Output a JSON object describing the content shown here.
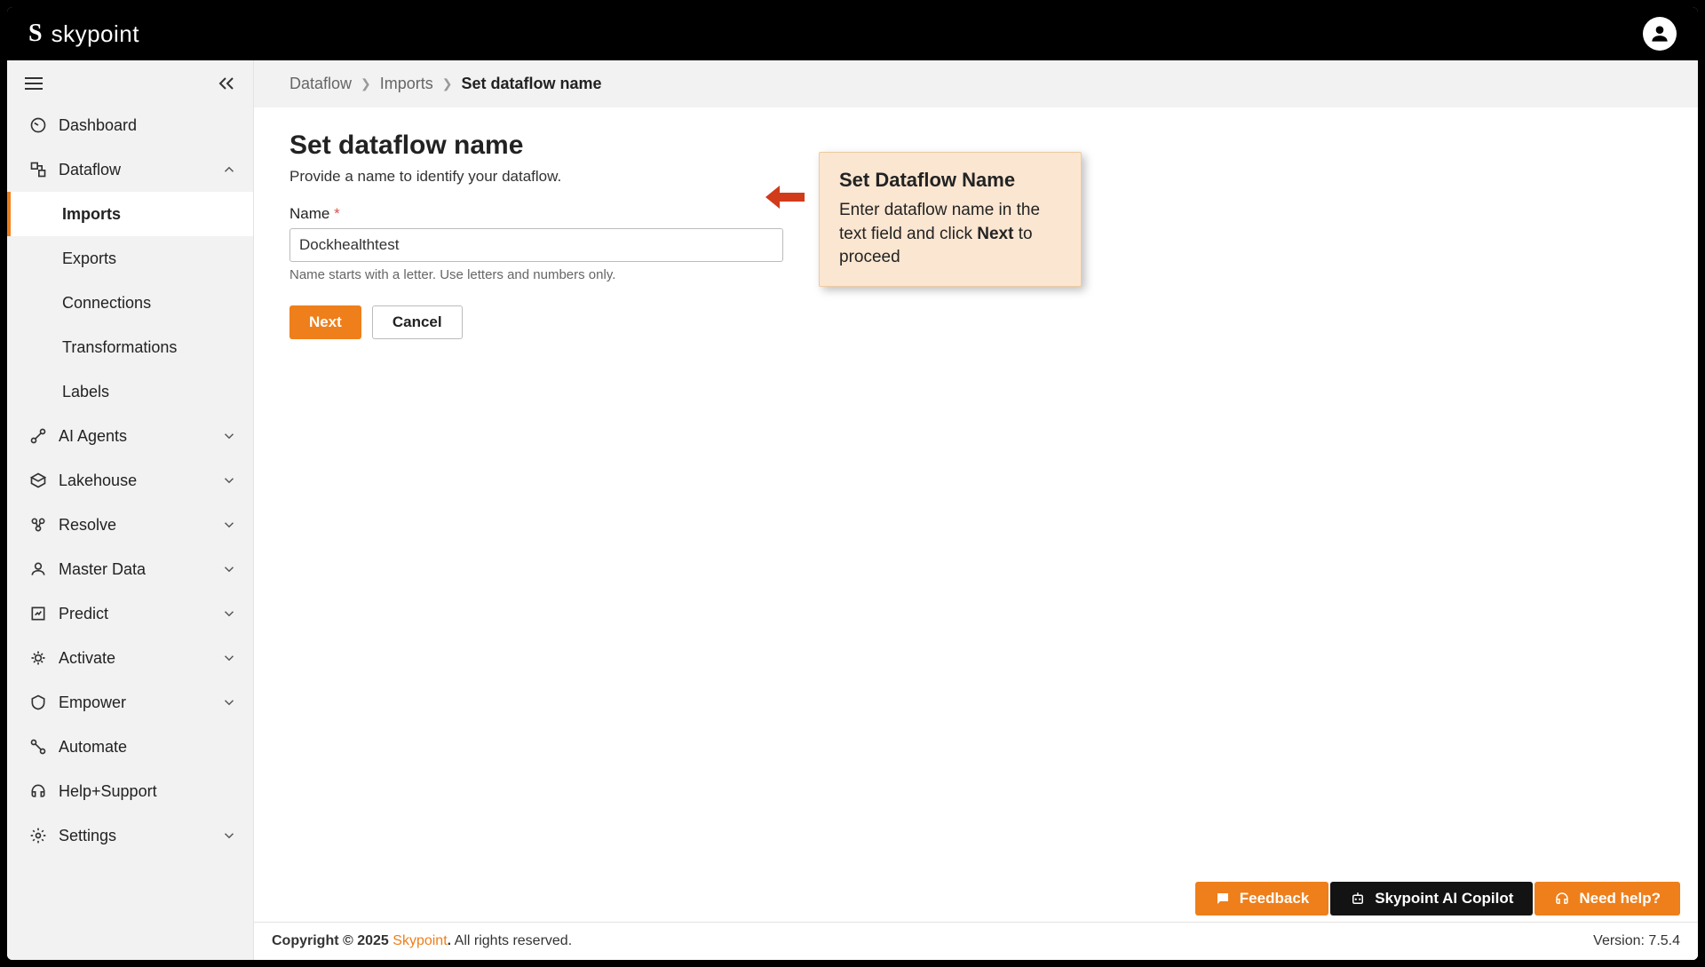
{
  "brand": {
    "logo_letter": "S",
    "name": "skypoint"
  },
  "sidebar": {
    "items": [
      {
        "label": "Dashboard"
      },
      {
        "label": "Dataflow",
        "expanded": true,
        "children": [
          {
            "label": "Imports",
            "active": true
          },
          {
            "label": "Exports"
          },
          {
            "label": "Connections"
          },
          {
            "label": "Transformations"
          },
          {
            "label": "Labels"
          }
        ]
      },
      {
        "label": "AI Agents"
      },
      {
        "label": "Lakehouse"
      },
      {
        "label": "Resolve"
      },
      {
        "label": "Master Data"
      },
      {
        "label": "Predict"
      },
      {
        "label": "Activate"
      },
      {
        "label": "Empower"
      },
      {
        "label": "Automate"
      },
      {
        "label": "Help+Support"
      },
      {
        "label": "Settings"
      }
    ]
  },
  "breadcrumb": {
    "items": [
      {
        "label": "Dataflow"
      },
      {
        "label": "Imports"
      },
      {
        "label": "Set dataflow name",
        "current": true
      }
    ]
  },
  "page": {
    "title": "Set dataflow name",
    "subtitle": "Provide a name to identify your dataflow.",
    "name_label": "Name",
    "required_marker": "*",
    "name_value": "Dockhealthtest",
    "helper": "Name starts with a letter. Use letters and numbers only.",
    "next": "Next",
    "cancel": "Cancel"
  },
  "callout": {
    "title": "Set Dataflow Name",
    "body_prefix": "Enter dataflow name in the text field and click ",
    "body_bold": "Next",
    "body_suffix": " to proceed"
  },
  "bottom": {
    "feedback": "Feedback",
    "copilot": "Skypoint AI Copilot",
    "help": "Need help?"
  },
  "footer": {
    "copyright_prefix": "Copyright © 2025 ",
    "company": "Skypoint",
    "copyright_suffix": ". All rights reserved.",
    "version": "Version: 7.5.4"
  }
}
